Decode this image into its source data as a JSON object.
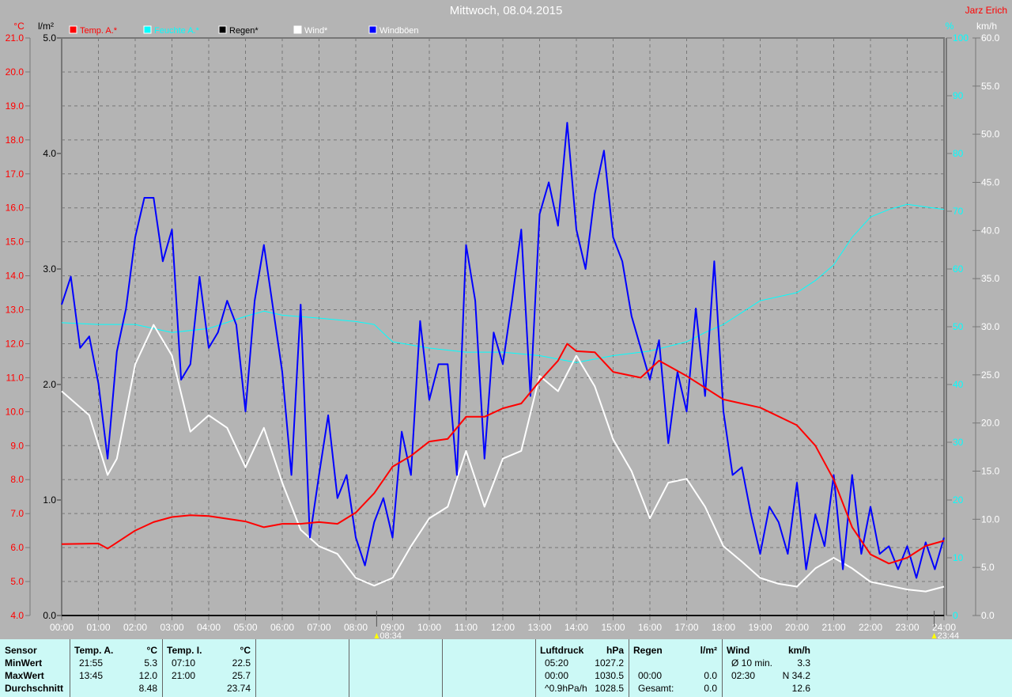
{
  "header": {
    "title": "Mittwoch, 08.04.2015",
    "author": "Jarz Erich"
  },
  "colors": {
    "temp": "#ff0000",
    "humidity": "#00ffff",
    "rain": "#000000",
    "wind": "#ffffff",
    "gusts": "#0000ff",
    "background": "#b4b4b4",
    "panel": "#ccf9f6"
  },
  "chart_data": {
    "type": "line",
    "grid": true,
    "legend_placement": "top-left",
    "x_label_times": [
      "00:00",
      "01:00",
      "02:00",
      "03:00",
      "04:00",
      "05:00",
      "06:00",
      "07:00",
      "08:00",
      "09:00",
      "10:00",
      "11:00",
      "12:00",
      "13:00",
      "14:00",
      "15:00",
      "16:00",
      "17:00",
      "18:00",
      "19:00",
      "20:00",
      "21:00",
      "22:00",
      "23:00",
      "24:00"
    ],
    "xlim_hours": [
      0,
      24
    ],
    "axes": {
      "temp": {
        "unit": "°C",
        "range": [
          4.0,
          21.0
        ],
        "step": 1.0
      },
      "rain": {
        "unit": "l/m²",
        "range": [
          0.0,
          5.0
        ],
        "step": 1.0
      },
      "humidity": {
        "unit": "%",
        "range": [
          0,
          100
        ],
        "step": 10
      },
      "wind": {
        "unit": "km/h",
        "range": [
          0.0,
          60.0
        ],
        "step": 5.0
      }
    },
    "annotations": [
      {
        "label": "08:34",
        "hour": 8.567,
        "icon": "sunrise-icon"
      },
      {
        "label": "23:44",
        "hour": 23.733,
        "icon": "moon-icon"
      }
    ],
    "series": [
      {
        "name": "Temp. A.*",
        "axis": "temp",
        "color": "#ff0000",
        "x": [
          0,
          1,
          1.25,
          2,
          2.5,
          3,
          3.5,
          4,
          5,
          5.5,
          6,
          6.5,
          7,
          7.5,
          8,
          8.5,
          9,
          9.5,
          10,
          10.5,
          11,
          11.5,
          12,
          12.5,
          13,
          13.5,
          13.75,
          14,
          14.5,
          15,
          15.75,
          16.25,
          17,
          18,
          19,
          20,
          20.5,
          21,
          21.5,
          22,
          22.5,
          23,
          23.5,
          24
        ],
        "y": [
          6.1,
          6.12,
          5.97,
          6.5,
          6.75,
          6.9,
          6.95,
          6.93,
          6.77,
          6.6,
          6.7,
          6.7,
          6.75,
          6.7,
          7.03,
          7.6,
          8.38,
          8.7,
          9.12,
          9.2,
          9.85,
          9.85,
          10.1,
          10.24,
          10.9,
          11.5,
          12.0,
          11.78,
          11.75,
          11.17,
          11.0,
          11.5,
          11.05,
          10.36,
          10.12,
          9.6,
          9.0,
          8.0,
          6.6,
          5.8,
          5.53,
          5.7,
          6.05,
          6.2
        ]
      },
      {
        "name": "Feuchte A.*",
        "axis": "humidity",
        "color": "#00ffff",
        "x": [
          0,
          1,
          2,
          3,
          4,
          5,
          5.5,
          6,
          7,
          8,
          8.5,
          9,
          10,
          11,
          12,
          13,
          14,
          15,
          16,
          17,
          17.5,
          18,
          19,
          20,
          20.5,
          21,
          21.5,
          22,
          22.5,
          23,
          24
        ],
        "y": [
          50.7,
          50.4,
          50.4,
          49,
          49.7,
          51.8,
          52.7,
          52,
          51.5,
          50.9,
          50.4,
          47.4,
          46.3,
          45.6,
          45.6,
          45,
          43.8,
          45,
          45.8,
          47.4,
          49,
          50.4,
          54.5,
          55.9,
          58,
          60.7,
          65.5,
          69,
          70.3,
          71.2,
          70.3
        ]
      },
      {
        "name": "Regen*",
        "axis": "rain",
        "color": "#000000",
        "x": [
          0,
          24
        ],
        "y": [
          0,
          0
        ]
      },
      {
        "name": "Wind*",
        "axis": "wind",
        "color": "#ffffff",
        "x": [
          0,
          0.75,
          1.25,
          1.5,
          2,
          2.5,
          3,
          3.5,
          4,
          4.5,
          5,
          5.5,
          6,
          6.5,
          7,
          7.5,
          8,
          8.5,
          9,
          9.5,
          10,
          10.5,
          11,
          11.5,
          12,
          12.5,
          13,
          13.5,
          14,
          14.5,
          15,
          15.5,
          16,
          16.5,
          17,
          17.5,
          18,
          18.5,
          19,
          19.5,
          20,
          20.5,
          21,
          21.5,
          22,
          22.5,
          23,
          23.5,
          24
        ],
        "y": [
          23.3,
          20.8,
          14.6,
          16.3,
          26.1,
          30.2,
          27,
          19.1,
          20.8,
          19.5,
          15.4,
          19.5,
          13.8,
          8.9,
          7.2,
          6.4,
          3.9,
          3.1,
          3.9,
          7.2,
          10.1,
          11.3,
          17.1,
          11.3,
          16.3,
          17.1,
          24.9,
          23.3,
          27,
          23.8,
          18.3,
          15.0,
          10.1,
          13.8,
          14.2,
          11.3,
          7.2,
          5.6,
          3.9,
          3.3,
          3.0,
          4.9,
          6.0,
          4.9,
          3.5,
          3.1,
          2.7,
          2.5,
          3.0
        ]
      },
      {
        "name": "Windböen",
        "axis": "wind",
        "color": "#0000ff",
        "x_step_hours": 0.25,
        "y": [
          32.3,
          35.2,
          27.8,
          29.0,
          24.1,
          16.3,
          27.4,
          31.9,
          39.3,
          43.4,
          43.4,
          36.8,
          40.1,
          24.5,
          26.1,
          35.2,
          27.8,
          29.4,
          32.7,
          30.2,
          21.2,
          32.7,
          38.5,
          31.9,
          25.3,
          14.6,
          32.3,
          8.1,
          14.6,
          20.8,
          12.2,
          14.6,
          8.1,
          5.2,
          9.7,
          12.2,
          8.1,
          19.1,
          14.6,
          30.6,
          22.4,
          26.1,
          26.1,
          14.6,
          38.5,
          32.7,
          16.3,
          29.4,
          26.1,
          32.7,
          40.1,
          22.8,
          41.7,
          45.0,
          40.5,
          51.2,
          40.1,
          36.0,
          43.8,
          48.3,
          39.3,
          36.8,
          31.1,
          27.8,
          24.5,
          28.6,
          17.9,
          25.3,
          21.2,
          31.9,
          22.8,
          36.8,
          21.2,
          14.6,
          15.4,
          10.5,
          6.4,
          11.3,
          9.7,
          6.4,
          13.8,
          4.8,
          10.5,
          7.2,
          14.6,
          4.8,
          14.6,
          6.4,
          11.3,
          6.4,
          7.2,
          4.8,
          7.2,
          3.9,
          7.6,
          4.8,
          8.1
        ]
      }
    ]
  },
  "summary": {
    "sensor": {
      "header": "Sensor",
      "rows": [
        "MinWert",
        "MaxWert",
        "Durchschnitt"
      ]
    },
    "temp_a": {
      "header": "Temp. A.",
      "unit": "°C",
      "rows": [
        [
          "21:55",
          "5.3"
        ],
        [
          "13:45",
          "12.0"
        ],
        [
          "",
          "8.48"
        ]
      ]
    },
    "temp_i": {
      "header": "Temp. I.",
      "unit": "°C",
      "rows": [
        [
          "07:10",
          "22.5"
        ],
        [
          "21:00",
          "25.7"
        ],
        [
          "",
          "23.74"
        ]
      ]
    },
    "pressure": {
      "header": "Luftdruck",
      "unit": "hPa",
      "rows": [
        [
          "05:20",
          "1027.2"
        ],
        [
          "00:00",
          "1030.5"
        ],
        [
          "^0.9hPa/h",
          "1028.5"
        ]
      ]
    },
    "rain": {
      "header": "Regen",
      "unit": "l/m²",
      "rows": [
        [
          "",
          ""
        ],
        [
          "00:00",
          "0.0"
        ],
        [
          "Gesamt:",
          "0.0"
        ]
      ]
    },
    "wind": {
      "header": "Wind",
      "unit": "km/h",
      "rows": [
        [
          "Ø 10 min.",
          "3.3"
        ],
        [
          "02:30",
          "N 34.2"
        ],
        [
          "",
          "12.6"
        ]
      ]
    }
  }
}
